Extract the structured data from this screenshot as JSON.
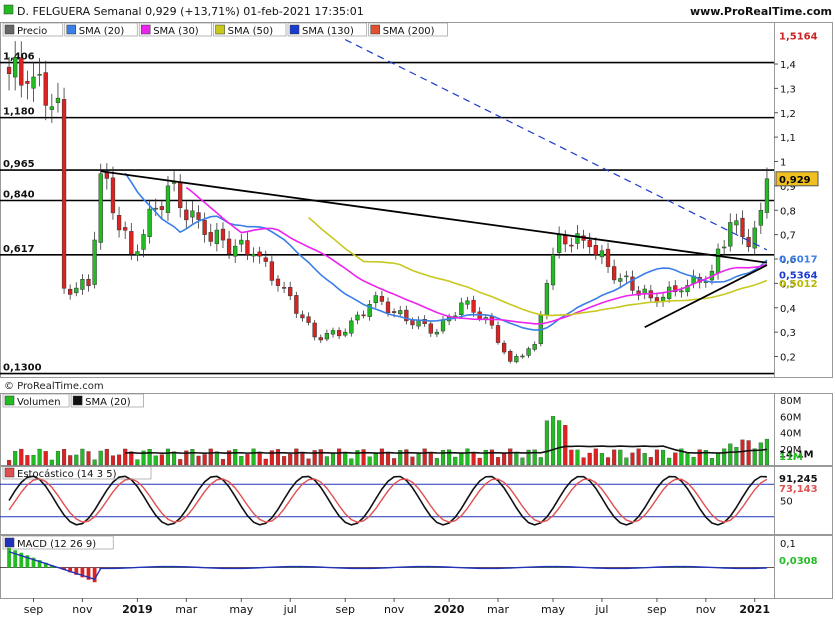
{
  "header": {
    "title": "D. FELGUERA  Semanal 0,929 (+13,71%) 01-feb-2021 17:35:01",
    "site": "www.ProRealTime.com",
    "credit": "© ProRealTime.com"
  },
  "colors": {
    "up": "#22bb22",
    "down": "#dd2222",
    "outline": "#333333",
    "sma20": "#3a7ee8",
    "sma30": "#ee22ee",
    "sma50": "#c8c820",
    "sma130": "#1a3bd0",
    "sma200": "#e05030",
    "volsma": "#111111",
    "stochK": "#111111",
    "stochD": "#e05050",
    "macd": "#2233bb",
    "macdSignal": "#e05050",
    "histUp": "#22bb22",
    "histDown": "#dd2222"
  },
  "legends": {
    "price": [
      {
        "label": "Precio",
        "color": "#666666"
      },
      {
        "label": "SMA (20)",
        "color": "#3a7ee8"
      },
      {
        "label": "SMA (30)",
        "color": "#ee22ee"
      },
      {
        "label": "SMA (50)",
        "color": "#c8c820"
      },
      {
        "label": "SMA (130)",
        "color": "#1a3bd0"
      },
      {
        "label": "SMA (200)",
        "color": "#e05030"
      }
    ],
    "volume": [
      {
        "label": "Volumen",
        "color": "#22bb22"
      },
      {
        "label": "SMA (20)",
        "color": "#111111"
      }
    ],
    "stoch": [
      {
        "label": "Estocástico (14 3 5)",
        "color": "#e05050"
      }
    ],
    "macd": [
      {
        "label": "MACD (12 26 9)",
        "color": "#2233bb"
      }
    ]
  },
  "chart_data": {
    "type": "candlestick",
    "ylim": [
      0.12,
      1.56
    ],
    "y_ticks": [
      "1,4",
      "1,3",
      "1,2",
      "1,1",
      "1",
      "0,9",
      "0,8",
      "0,7",
      "0,6",
      "0,5",
      "0,4",
      "0,3",
      "0,2"
    ],
    "y_tick_values": [
      1.4,
      1.3,
      1.2,
      1.1,
      1.0,
      0.9,
      0.8,
      0.7,
      0.6,
      0.5,
      0.4,
      0.3,
      0.2
    ],
    "x_labels": [
      "sep",
      "nov",
      "2019",
      "mar",
      "may",
      "jul",
      "sep",
      "nov",
      "2020",
      "mar",
      "may",
      "jul",
      "sep",
      "nov",
      "2021"
    ],
    "x_label_index": [
      4,
      12,
      21,
      29,
      38,
      46,
      55,
      63,
      72,
      80,
      89,
      97,
      106,
      114,
      122
    ],
    "horizontal_levels": [
      {
        "value": 1.406,
        "label": "1,406"
      },
      {
        "value": 1.18,
        "label": "1,180"
      },
      {
        "value": 0.965,
        "label": "0,965"
      },
      {
        "value": 0.84,
        "label": "0,840"
      },
      {
        "value": 0.617,
        "label": "0,617"
      },
      {
        "value": 0.13,
        "label": "0,1300"
      }
    ],
    "value_tags": [
      {
        "text": "1,5164",
        "value": 1.5164,
        "style": "plain",
        "color": "#cc2222"
      },
      {
        "text": "0,929",
        "value": 0.929,
        "style": "filled",
        "color": "#f0c020"
      },
      {
        "text": "0,6017",
        "value": 0.6017,
        "style": "plain",
        "color": "#3a7ee8"
      },
      {
        "text": "0,5364",
        "value": 0.5364,
        "style": "plain",
        "color": "#1a3bd0"
      },
      {
        "text": "0,5012",
        "value": 0.5012,
        "style": "plain",
        "color": "#b8b800"
      }
    ],
    "trendlines": [
      {
        "x": [
          15,
          124
        ],
        "y": [
          0.96,
          0.585
        ]
      },
      {
        "x": [
          104,
          124
        ],
        "y": [
          0.32,
          0.575
        ]
      }
    ],
    "ohlc_key_points": [
      {
        "i": 0,
        "c": 1.36
      },
      {
        "i": 3,
        "c": 1.32
      },
      {
        "i": 8,
        "c": 1.26
      },
      {
        "i": 9,
        "c": 0.48
      },
      {
        "i": 13,
        "c": 0.49
      },
      {
        "i": 15,
        "c": 0.95
      },
      {
        "i": 20,
        "c": 0.62
      },
      {
        "i": 26,
        "c": 0.9
      },
      {
        "i": 32,
        "c": 0.7
      },
      {
        "i": 40,
        "c": 0.62
      },
      {
        "i": 45,
        "c": 0.48
      },
      {
        "i": 50,
        "c": 0.28
      },
      {
        "i": 55,
        "c": 0.3
      },
      {
        "i": 60,
        "c": 0.45
      },
      {
        "i": 63,
        "c": 0.38
      },
      {
        "i": 70,
        "c": 0.3
      },
      {
        "i": 74,
        "c": 0.42
      },
      {
        "i": 78,
        "c": 0.36
      },
      {
        "i": 82,
        "c": 0.18
      },
      {
        "i": 86,
        "c": 0.25
      },
      {
        "i": 88,
        "c": 0.5
      },
      {
        "i": 90,
        "c": 0.7
      },
      {
        "i": 95,
        "c": 0.65
      },
      {
        "i": 100,
        "c": 0.52
      },
      {
        "i": 105,
        "c": 0.44
      },
      {
        "i": 110,
        "c": 0.47
      },
      {
        "i": 115,
        "c": 0.55
      },
      {
        "i": 118,
        "c": 0.75
      },
      {
        "i": 121,
        "c": 0.65
      },
      {
        "i": 123,
        "c": 0.8
      },
      {
        "i": 124,
        "c": 0.929
      }
    ],
    "volume": {
      "ylim": [
        0,
        85
      ],
      "y_ticks": [
        "80M",
        "60M",
        "40M",
        "20M"
      ],
      "y_tick_values": [
        80,
        60,
        40,
        20
      ],
      "tags": [
        {
          "text": "14,1M",
          "value": 14.1,
          "color": "#111111"
        },
        {
          "text": "11M",
          "value": 11,
          "color": "#22bb22"
        }
      ]
    },
    "stochastic": {
      "ylim": [
        -10,
        110
      ],
      "y_ticks": [
        "50"
      ],
      "levels": [
        80,
        20
      ],
      "tags": [
        {
          "text": "91,245",
          "value": 91.245,
          "color": "#111111"
        },
        {
          "text": "73,143",
          "value": 73.143,
          "color": "#e05050"
        }
      ]
    },
    "macd": {
      "ylim": [
        -0.12,
        0.12
      ],
      "y_ticks": [
        "0,1"
      ],
      "tags": [
        {
          "text": "0,0308",
          "value": 0.0308,
          "color": "#22bb22"
        }
      ]
    }
  }
}
